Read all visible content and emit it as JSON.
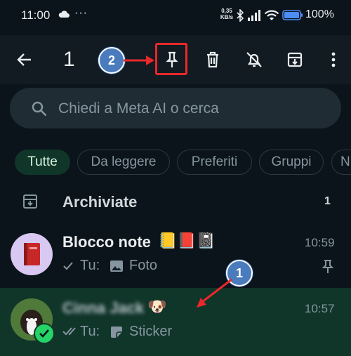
{
  "status_bar": {
    "time": "11:00",
    "more": "···",
    "net_speed_value": "0,35",
    "net_speed_unit": "KB/s",
    "battery_percent": "100%"
  },
  "action_bar": {
    "selected_count": "1",
    "annotation_badge": "2"
  },
  "search": {
    "placeholder": "Chiedi a Meta AI o cerca"
  },
  "filters": [
    {
      "label": "Tutte",
      "active": true
    },
    {
      "label": "Da leggere",
      "active": false
    },
    {
      "label": "Preferiti",
      "active": false
    },
    {
      "label": "Gruppi",
      "active": false
    },
    {
      "label": "N",
      "active": false
    }
  ],
  "archived": {
    "label": "Archiviate",
    "count": "1"
  },
  "chats": [
    {
      "name": "Blocco note",
      "emoji": "📒📕📓",
      "time": "10:59",
      "prefix": "Tu:",
      "preview": "Foto",
      "pinned": true
    },
    {
      "name": "Cinna Jack",
      "emoji": "🐶",
      "time": "10:57",
      "prefix": "Tu:",
      "preview": "Sticker",
      "selected": true
    }
  ],
  "annotation_badge_1": "1",
  "colors": {
    "background": "#0b141a",
    "selected_row": "#103529",
    "accent_green": "#25d366",
    "annotation_red": "#e8282b",
    "annotation_blue": "#4a7bbd"
  }
}
